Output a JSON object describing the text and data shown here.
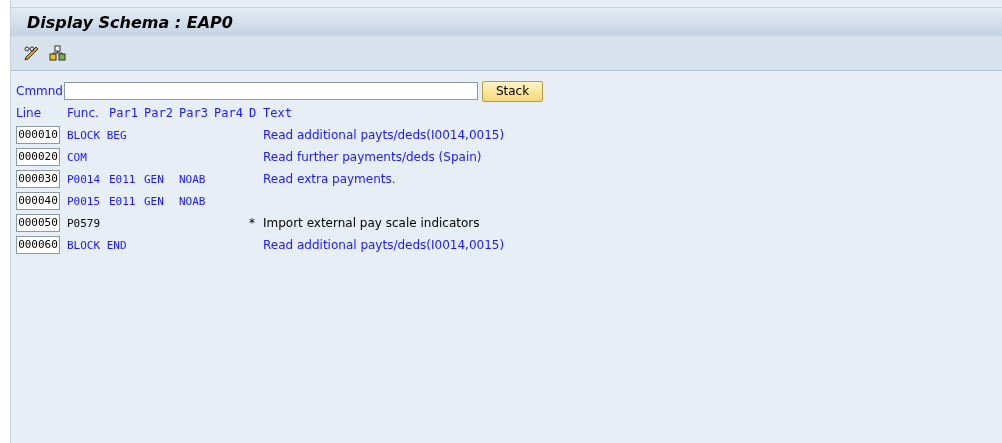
{
  "window": {
    "title": "Display Schema : EAP0"
  },
  "command": {
    "label": "Cmmnd",
    "button": "Stack"
  },
  "columns": [
    "Line",
    "Func.",
    "Par1",
    "Par2",
    "Par3",
    "Par4",
    "D",
    "Text"
  ],
  "rows": [
    {
      "line": "000010",
      "func": "BLOCK BEG",
      "text": "Read additional payts/deds(I0014,0015)",
      "commented": false
    },
    {
      "line": "000020",
      "func": "COM",
      "text": "Read further payments/deds (Spain)",
      "commented": false
    },
    {
      "line": "000030",
      "func": "P0014",
      "par1": "E011",
      "par2": "GEN",
      "par3": "NOAB",
      "text": "Read extra payments.",
      "commented": false
    },
    {
      "line": "000040",
      "func": "P0015",
      "par1": "E011",
      "par2": "GEN",
      "par3": "NOAB",
      "commented": false
    },
    {
      "line": "000050",
      "func": "P0579",
      "d": "*",
      "text": "Import external pay scale indicators",
      "commented": true
    },
    {
      "line": "000060",
      "func": "BLOCK END",
      "text": "Read additional payts/deds(I0014,0015)",
      "commented": false
    }
  ]
}
